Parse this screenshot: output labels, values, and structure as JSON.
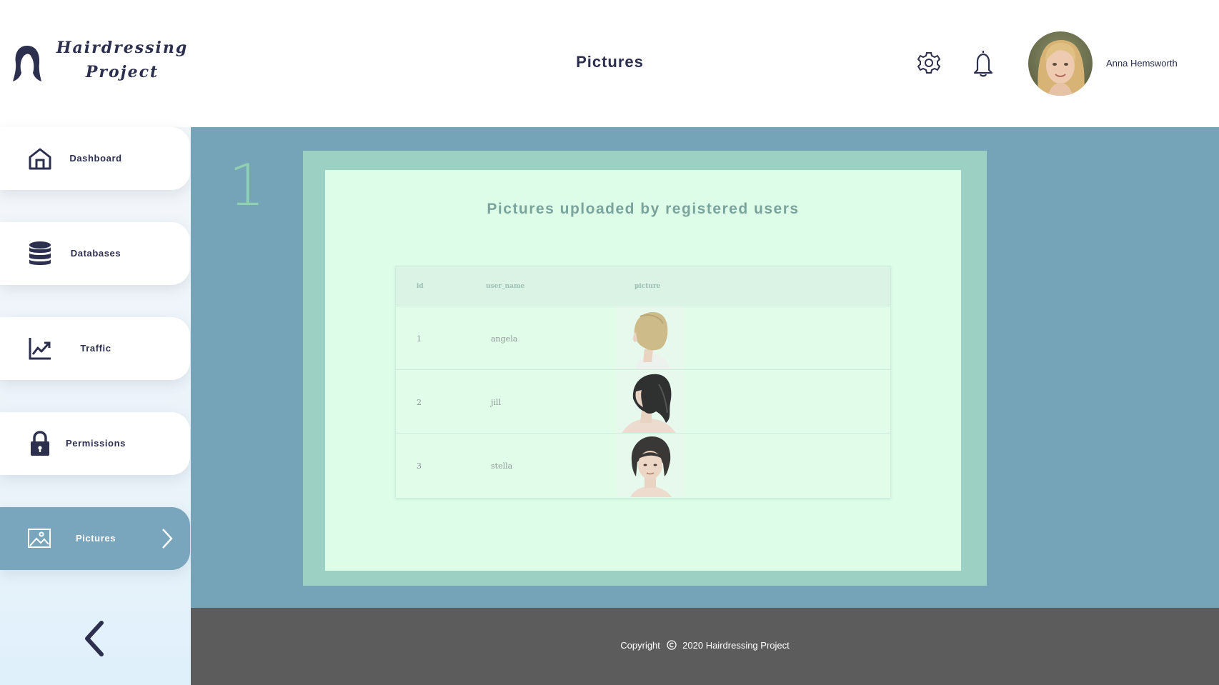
{
  "brand": {
    "line1": "Hairdressing",
    "line2": "Project",
    "logo_icon": "woman-head-icon"
  },
  "header": {
    "title": "Pictures",
    "settings_icon": "gear-icon",
    "notifications_icon": "bell-icon",
    "user": {
      "name": "Anna Hemsworth",
      "avatar": "user-avatar"
    }
  },
  "sidebar": {
    "items": [
      {
        "label": "Dashboard",
        "icon": "home-icon",
        "active": false
      },
      {
        "label": "Databases",
        "icon": "database-icon",
        "active": false
      },
      {
        "label": "Traffic",
        "icon": "chart-line-icon",
        "active": false
      },
      {
        "label": "Permissions",
        "icon": "lock-icon",
        "active": false
      },
      {
        "label": "Pictures",
        "icon": "image-icon",
        "active": true
      }
    ],
    "collapse_icon": "chevron-left-icon"
  },
  "main": {
    "page_number": "1",
    "card_title": "Pictures uploaded by registered users",
    "table": {
      "columns": [
        "id",
        "user_name",
        "picture"
      ],
      "rows": [
        {
          "id": "1",
          "user_name": "angela",
          "picture": "hairstyle-photo-blonde-bob"
        },
        {
          "id": "2",
          "user_name": "jill",
          "picture": "hairstyle-photo-dark-layered"
        },
        {
          "id": "3",
          "user_name": "stella",
          "picture": "hairstyle-photo-dark-short"
        }
      ]
    }
  },
  "footer": {
    "copyright_prefix": "Copyright",
    "copyright_text": "2020 Hairdressing Project"
  },
  "colors": {
    "navy": "#2c2f4e",
    "main_bg": "#75a3b7",
    "card_outer": "#9bd0c2",
    "card_inner": "#ddfde8",
    "active_item": "#7aa6bd",
    "footer_bg": "#5c5c5c",
    "page_number": "#8fd0b0"
  }
}
